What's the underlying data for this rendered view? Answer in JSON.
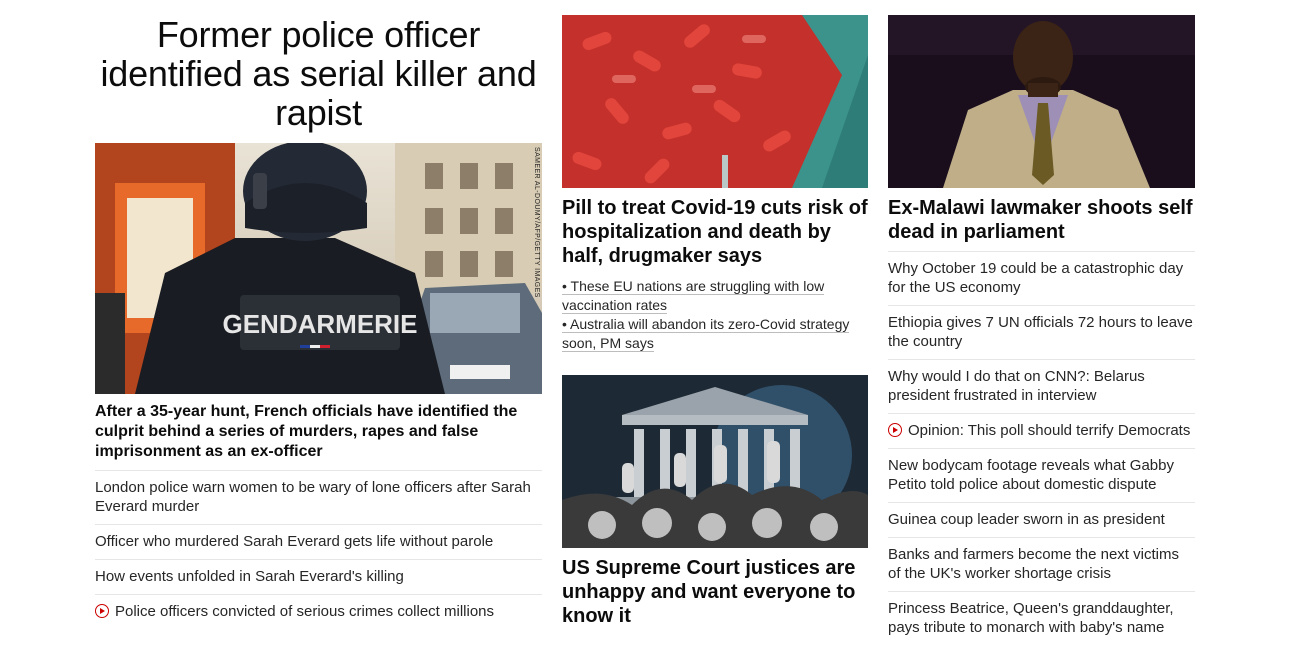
{
  "col1": {
    "hero_title": "Former police officer identified as serial killer and rapist",
    "photo_credit": "SAMEER AL-DOUMY/AFP/GETTY IMAGES",
    "photo_vest_text": "GENDARMERIE",
    "headline": "After a 35-year hunt, French officials have identified the culprit behind a series of murders, rapes and false imprisonment as an ex-officer",
    "links": [
      "London police warn women to be wary of lone officers after Sarah Everard murder",
      "Officer who murdered Sarah Everard gets life without parole",
      "How events unfolded in Sarah Everard's killing",
      "Police officers convicted of serious crimes collect millions"
    ]
  },
  "col2": {
    "story1": {
      "headline": "Pill to treat Covid-19 cuts risk of hospitalization and death by half, drugmaker says",
      "sub_links": [
        "• These EU nations are struggling with low vaccination rates",
        "• Australia will abandon its zero-Covid strategy soon, PM says"
      ]
    },
    "story2": {
      "headline": "US Supreme Court justices are unhappy and want everyone to know it"
    }
  },
  "col3": {
    "headline": "Ex-Malawi lawmaker shoots self dead in parliament",
    "links": [
      "Why October 19 could be a catastrophic day for the US economy",
      "Ethiopia gives 7 UN officials 72 hours to leave the country",
      "Why would I do that on CNN?: Belarus president frustrated in interview",
      "Opinion: This poll should terrify Democrats",
      "New bodycam footage reveals what Gabby Petito told police about domestic dispute",
      "Guinea coup leader sworn in as president",
      "Banks and farmers become the next victims of the UK's worker shortage crisis",
      "Princess Beatrice, Queen's granddaughter, pays tribute to monarch with baby's name"
    ]
  },
  "colors": {
    "headline": "#0c0c0c",
    "text": "#262626",
    "divider": "#e6e6e6",
    "video_icon": "#cc0000"
  }
}
